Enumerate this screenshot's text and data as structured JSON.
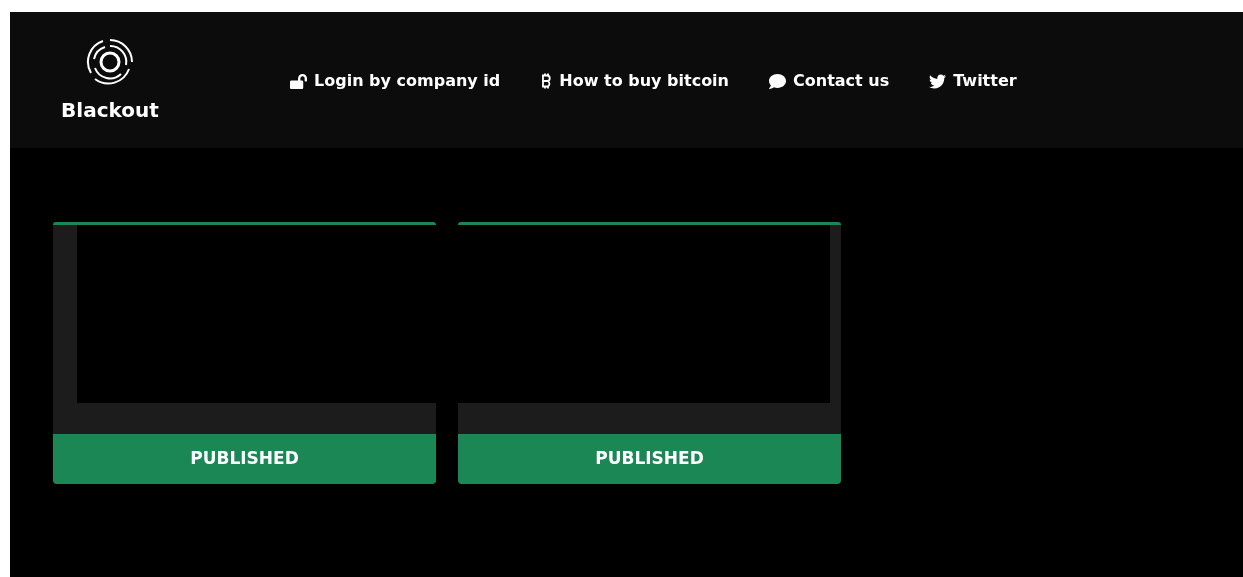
{
  "brand": {
    "name": "Blackout"
  },
  "nav": [
    {
      "label": "Login by company id",
      "kind": "lock"
    },
    {
      "label": "How to buy bitcoin",
      "kind": "bitcoin"
    },
    {
      "label": "Contact us",
      "kind": "chat"
    },
    {
      "label": "Twitter",
      "kind": "bird"
    }
  ],
  "cards": [
    {
      "status": "PUBLISHED",
      "kind": "inset"
    },
    {
      "status": "PUBLISHED",
      "kind": "flush"
    }
  ]
}
